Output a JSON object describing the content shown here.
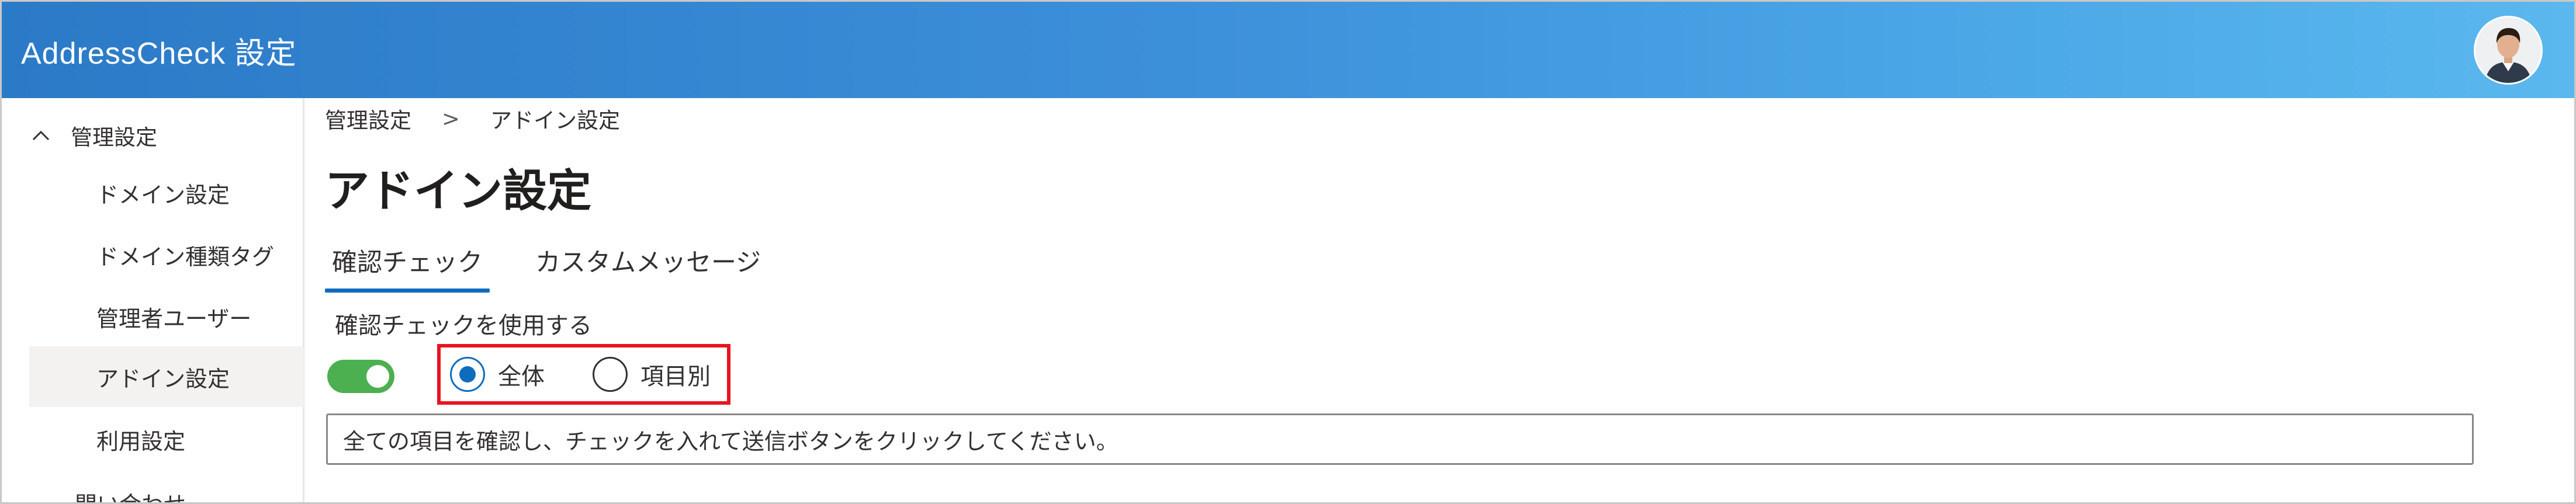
{
  "app": {
    "title": "AddressCheck 設定"
  },
  "sidebar": {
    "group_label": "管理設定",
    "items": [
      {
        "label": "ドメイン設定"
      },
      {
        "label": "ドメイン種類タグ"
      },
      {
        "label": "管理者ユーザー"
      },
      {
        "label": "アドイン設定",
        "active": true
      },
      {
        "label": "利用設定"
      }
    ],
    "next_group_label": "問い合わせ"
  },
  "breadcrumb": {
    "root": "管理設定",
    "separator": ">",
    "current": "アドイン設定"
  },
  "page": {
    "title": "アドイン設定"
  },
  "tabs": [
    {
      "label": "確認チェック",
      "selected": true
    },
    {
      "label": "カスタムメッセージ",
      "selected": false
    }
  ],
  "settings": {
    "use_check_label": "確認チェックを使用する",
    "toggle_on": true,
    "scope_options": [
      {
        "label": "全体",
        "checked": true
      },
      {
        "label": "項目別",
        "checked": false
      }
    ],
    "message_value": "全ての項目を確認し、チェックを入れて送信ボタンをクリックしてください。"
  },
  "colors": {
    "header_start": "#2b7ac7",
    "header_end": "#5ab8ee",
    "accent": "#0f6cbd",
    "toggle_on": "#4caf50",
    "highlight_box": "#e8141f"
  },
  "icons": {
    "sidebar_group": "chevron-up-icon",
    "avatar": "user-avatar"
  }
}
